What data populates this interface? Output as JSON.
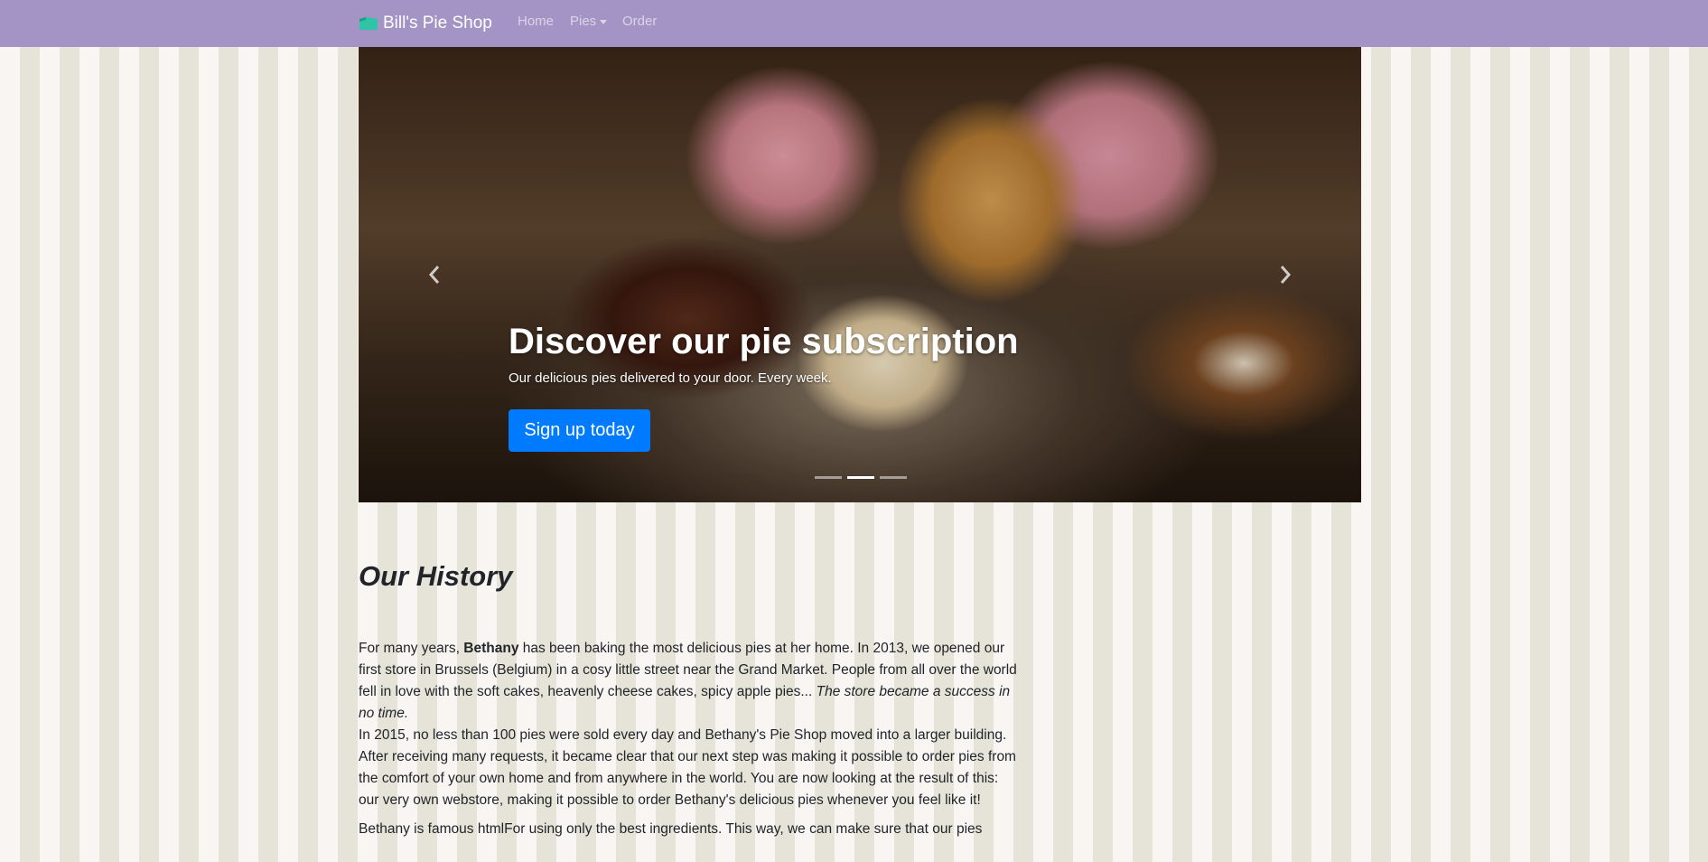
{
  "nav": {
    "brand": "Bill's Pie Shop",
    "links": [
      "Home",
      "Pies",
      "Order"
    ]
  },
  "carousel": {
    "title": "Discover our pie subscription",
    "subtitle": "Our delicious pies delivered to your door. Every week.",
    "button_label": "Sign up today",
    "slide_count": 3,
    "active_index": 1
  },
  "history": {
    "heading": "Our History",
    "p1_a": "For many years, ",
    "p1_bold": "Bethany",
    "p1_b": " has been baking the most delicious pies at her home. In 2013, we opened our first store in Brussels (Belgium) in a cosy little street near the Grand Market. People from all over the world fell in love with the soft cakes, heavenly cheese cakes, spicy apple pies... ",
    "p1_italic": "The store became a success in no time.",
    "p1_c": "In 2015, no less than 100 pies were sold every day and Bethany's Pie Shop moved into a larger building. After receiving many requests, it became clear that our next step was making it possible to order pies from the comfort of your own home and from anywhere in the world. You are now looking at the result of this: our very own webstore, making it possible to order Bethany's delicious pies whenever you feel like it!",
    "p2": "Bethany is famous htmlFor using only the best ingredients. This way, we can make sure that our pies"
  },
  "colors": {
    "navbar": "#a394c5",
    "button": "#007bff",
    "stripe_light": "#f8f5f2",
    "stripe_dark": "#e6e3d8"
  }
}
